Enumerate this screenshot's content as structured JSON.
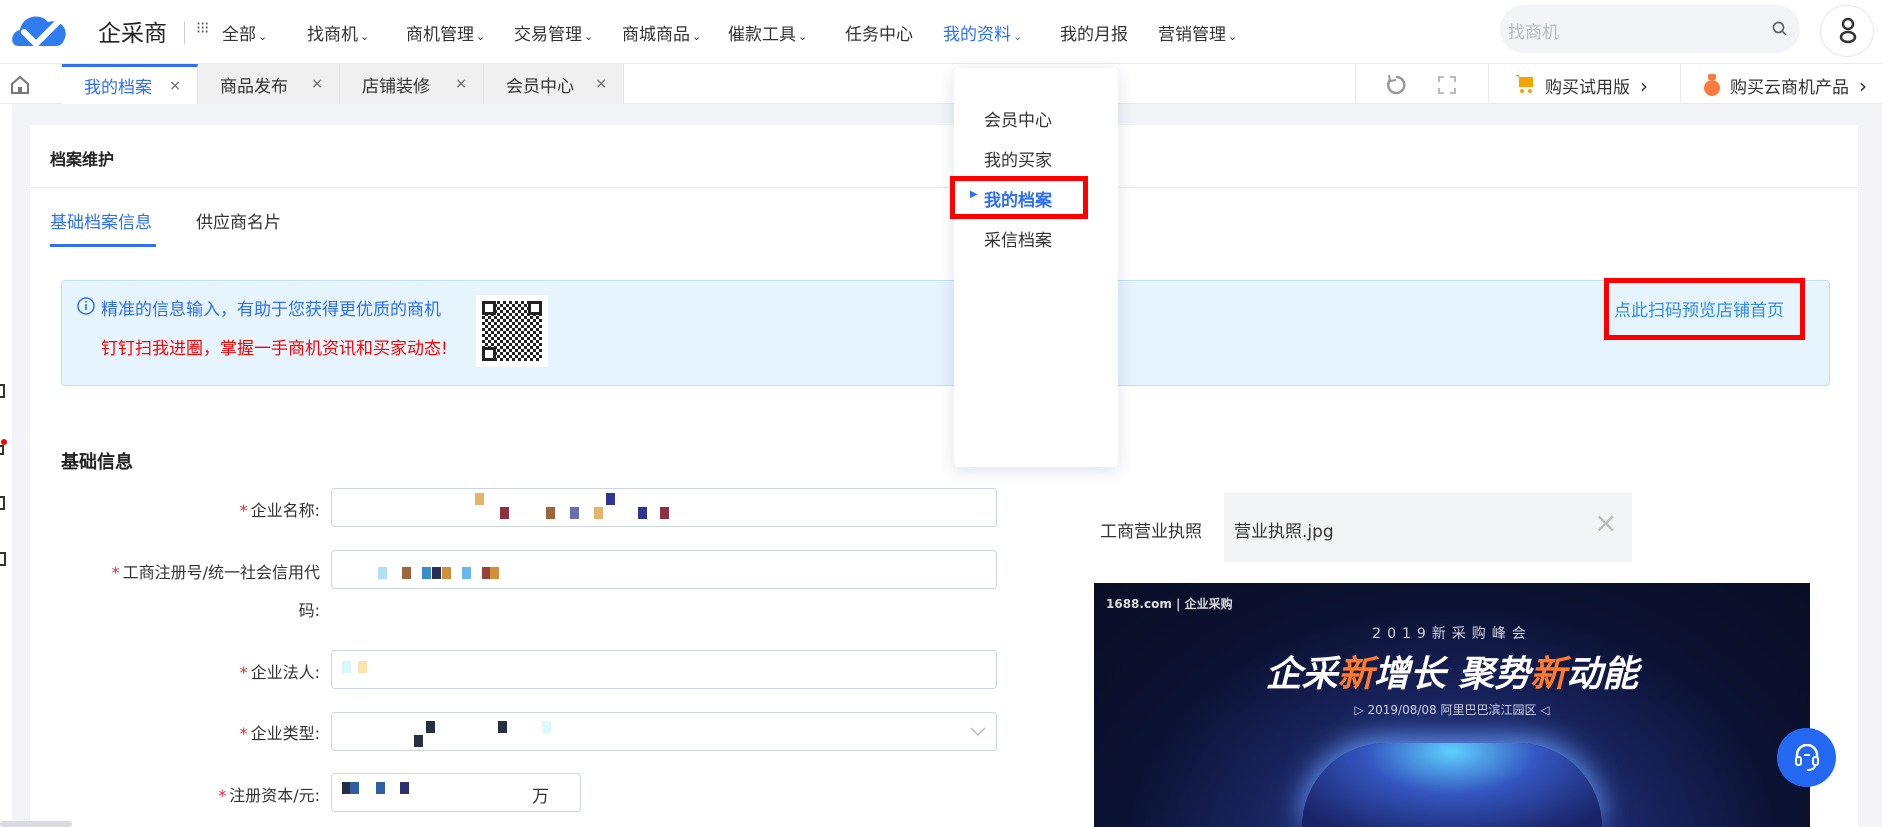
{
  "header": {
    "brand": "企采商",
    "nav": [
      {
        "label": "全部",
        "dropdown": true
      },
      {
        "label": "找商机",
        "dropdown": true
      },
      {
        "label": "商机管理",
        "dropdown": true
      },
      {
        "label": "交易管理",
        "dropdown": true
      },
      {
        "label": "商城商品",
        "dropdown": true
      },
      {
        "label": "催款工具",
        "dropdown": true
      },
      {
        "label": "任务中心",
        "dropdown": false
      },
      {
        "label": "我的资料",
        "dropdown": true,
        "active": true
      },
      {
        "label": "我的月报",
        "dropdown": false
      },
      {
        "label": "营销管理",
        "dropdown": true
      }
    ],
    "chevron": "⌄",
    "search_placeholder": "找商机"
  },
  "tabbar": {
    "tabs": [
      {
        "label": "我的档案",
        "active": true
      },
      {
        "label": "商品发布"
      },
      {
        "label": "店铺装修"
      },
      {
        "label": "会员中心"
      }
    ],
    "close": "×",
    "buy_trial": "购买试用版",
    "buy_cloud": "购买云商机产品",
    "arrow": "›"
  },
  "dropdown_menu": {
    "items": [
      {
        "label": "会员中心"
      },
      {
        "label": "我的买家"
      },
      {
        "label": "我的档案",
        "active": true
      },
      {
        "label": "采信档案"
      }
    ]
  },
  "page": {
    "title": "档案维护",
    "tabs": [
      {
        "label": "基础档案信息",
        "active": true
      },
      {
        "label": "供应商名片"
      }
    ],
    "info": {
      "line1": "精准的信息输入，有助于您获得更优质的商机",
      "line2": "钉钉扫我进圈，掌握一手商机资讯和买家动态!",
      "preview_link": "点此扫码预览店铺首页"
    },
    "section_title": "基础信息",
    "form": {
      "company_name": "企业名称:",
      "reg_no_a": "工商注册号/统一社会信用代",
      "reg_no_b": "码:",
      "legal_person": "企业法人:",
      "company_type": "企业类型:",
      "capital": "注册资本/元:",
      "capital_unit": "万"
    },
    "license": {
      "label": "工商营业执照",
      "file": "营业执照.jpg",
      "remove": "×"
    },
    "banner": {
      "brand": "1688.com",
      "brand2": "企业采购",
      "event": "2019新采购峰会",
      "slogan_a": "企采",
      "slogan_b": "新",
      "slogan_c": "增长",
      "slogan_d": "聚势",
      "slogan_e": "新",
      "slogan_f": "动能",
      "date": "2019/08/08 阿里巴巴滨江园区"
    }
  },
  "colors": {
    "accent": "#2f6ff0",
    "highlight": "#ff0000",
    "info_bg": "#e6f4fd"
  }
}
